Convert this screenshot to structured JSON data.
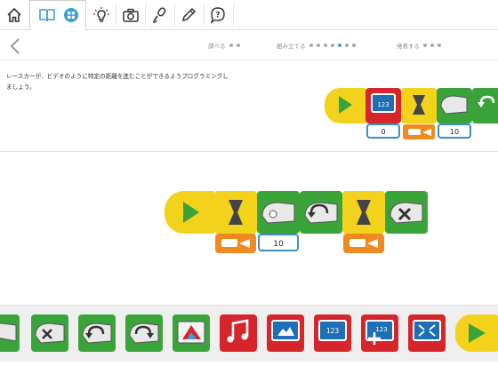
{
  "toolbar": {
    "items": [
      "home",
      "book",
      "lightbulb",
      "camera",
      "microphone",
      "pencil",
      "help"
    ]
  },
  "progress": {
    "stages": [
      {
        "label": "調べる",
        "dots": 2,
        "active_dot": -1
      },
      {
        "label": "組み立てる",
        "dots": 7,
        "active_dot": 4
      },
      {
        "label": "発表する",
        "dots": 3,
        "active_dot": -1
      }
    ]
  },
  "instruction": {
    "text": "レースカーが、ビデオのように特定の距離を進むことができるようプログラミングしましょう。"
  },
  "example_program": {
    "display_value": "0",
    "motor_value": "10"
  },
  "workspace_program": {
    "motor_value": "10"
  },
  "palette": {
    "display_label": "123"
  },
  "colors": {
    "start_yellow": "#f2d21a",
    "motor_green": "#3aa43b",
    "wait_yellow": "#f2d21a",
    "display_red": "#d6262b",
    "input_orange": "#f08a1e",
    "chip_blue": "#3a8ec9"
  }
}
